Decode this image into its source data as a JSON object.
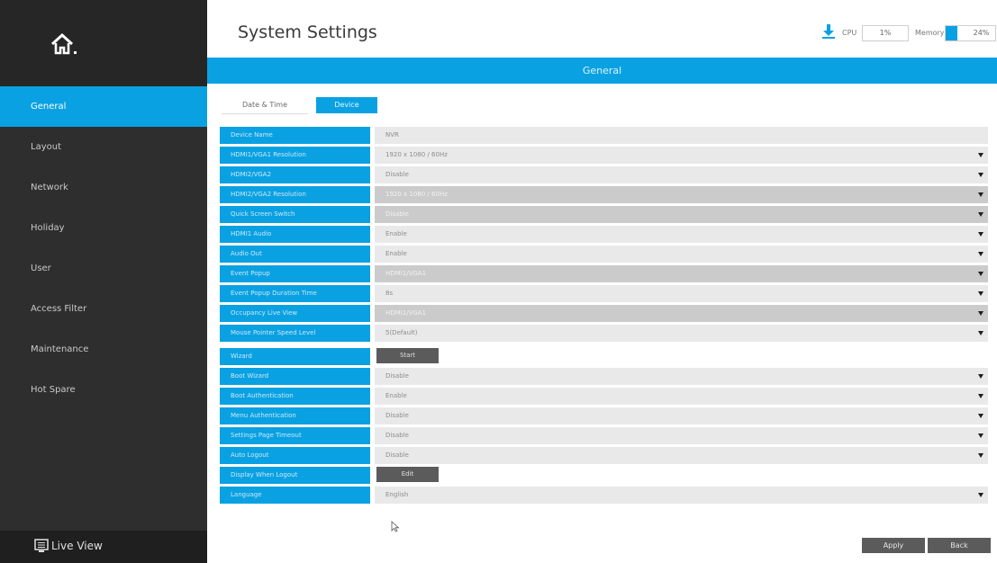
{
  "sidebar": {
    "items": [
      {
        "label": "General"
      },
      {
        "label": "Layout"
      },
      {
        "label": "Network"
      },
      {
        "label": "Holiday"
      },
      {
        "label": "User"
      },
      {
        "label": "Access Filter"
      },
      {
        "label": "Maintenance"
      },
      {
        "label": "Hot Spare"
      }
    ],
    "active_index": 0,
    "live_view_label": "Live View"
  },
  "header": {
    "title": "System Settings",
    "cpu_label": "CPU",
    "cpu_value": "1%",
    "memory_label": "Memory",
    "memory_value": "24%",
    "memory_fraction": 0.24
  },
  "banner": {
    "title": "General"
  },
  "tabs": [
    {
      "label": "Date & Time"
    },
    {
      "label": "Device"
    }
  ],
  "settings": [
    {
      "label": "Device Name",
      "value": "NVR"
    },
    {
      "label": "HDMI1/VGA1 Resolution",
      "value": "1920 x 1080 / 60Hz"
    },
    {
      "label": "HDMI2/VGA2",
      "value": "Disable"
    },
    {
      "label": "HDMI2/VGA2 Resolution",
      "value": "1920 x 1080 / 60Hz"
    },
    {
      "label": "Quick Screen Switch",
      "value": "Disable"
    },
    {
      "label": "HDMI1 Audio",
      "value": "Enable"
    },
    {
      "label": "Audio Out",
      "value": "Enable"
    },
    {
      "label": "Event Popup",
      "value": "HDMI1/VGA1"
    },
    {
      "label": "Event Popup Duration Time",
      "value": "8s"
    },
    {
      "label": "Occupancy Live View",
      "value": "HDMI1/VGA1"
    },
    {
      "label": "Mouse Pointer Speed Level",
      "value": "5(Default)"
    },
    {
      "label": "Wizard",
      "button": "Start"
    },
    {
      "label": "Boot Wizard",
      "value": "Disable"
    },
    {
      "label": "Boot Authentication",
      "value": "Enable"
    },
    {
      "label": "Menu Authentication",
      "value": "Disable"
    },
    {
      "label": "Settings Page Timeout",
      "value": "Disable"
    },
    {
      "label": "Auto Logout",
      "value": "Disable"
    },
    {
      "label": "Display When Logout",
      "button": "Edit"
    },
    {
      "label": "Language",
      "value": "English"
    }
  ],
  "footer": {
    "apply_label": "Apply",
    "back_label": "Back"
  },
  "colors": {
    "accent": "#0aa1e3",
    "sidebar": "#2e2e2e",
    "button": "#5b5b5b"
  },
  "icons": [
    "home-icon",
    "download-icon",
    "monitor-icon",
    "dropdown-arrow-icon",
    "mouse-cursor-icon"
  ]
}
